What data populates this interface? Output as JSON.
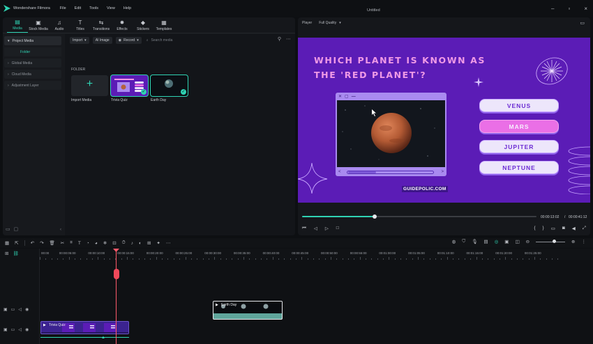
{
  "app": {
    "name": "Wondershare Filmora",
    "menus": [
      "File",
      "Edit",
      "Tools",
      "View",
      "Help"
    ],
    "document_title": "Untitled"
  },
  "toolbar_tabs": [
    {
      "label": "Media",
      "icon": "media-icon",
      "glyph": "▤"
    },
    {
      "label": "Stock Media",
      "icon": "stock-media-icon",
      "glyph": "▣"
    },
    {
      "label": "Audio",
      "icon": "music-note-icon",
      "glyph": "♫"
    },
    {
      "label": "Titles",
      "icon": "titles-icon",
      "glyph": "T"
    },
    {
      "label": "Transitions",
      "icon": "transitions-icon",
      "glyph": "⇆"
    },
    {
      "label": "Effects",
      "icon": "effects-icon",
      "glyph": "✸"
    },
    {
      "label": "Stickers",
      "icon": "stickers-icon",
      "glyph": "◆"
    },
    {
      "label": "Templates",
      "icon": "templates-icon",
      "glyph": "▦"
    }
  ],
  "sidebar": {
    "items": [
      {
        "label": "Project Media"
      },
      {
        "label": "Global Media"
      },
      {
        "label": "Cloud Media"
      },
      {
        "label": "Adjustment Layer"
      }
    ],
    "sub_item": "Folder"
  },
  "media": {
    "import_label": "Import",
    "ai_image_label": "AI Image",
    "record_label": "Record",
    "search_placeholder": "Search media",
    "folder_label": "FOLDER",
    "items": [
      {
        "label": "Import Media"
      },
      {
        "label": "Trivia Quiz"
      },
      {
        "label": "Earth Day"
      }
    ]
  },
  "player": {
    "label": "Player",
    "quality": "Full Quality",
    "current_time": "00:00:13:02",
    "separator": "/",
    "total_time": "00:00:41:12",
    "progress": 0.31
  },
  "slide": {
    "question_line1": "WHICH PLANET IS KNOWN AS",
    "question_line2": "THE 'RED PLANET'?",
    "answers": [
      "VENUS",
      "MARS",
      "JUPITER",
      "NEPTUNE"
    ],
    "highlighted_answer": "MARS",
    "brand": "GUIDEPOLIC.COM",
    "colors": {
      "background": "#5b1cb6",
      "title": "#f09ae6",
      "answer_highlight": "#ea6fe6"
    }
  },
  "timeline": {
    "ruler_labels": [
      "00:00",
      "00:00:05:00",
      "00:00:10:00",
      "00:00:15:00",
      "00:00:20:00",
      "00:00:25:00",
      "00:00:30:00",
      "00:00:35:00",
      "00:00:40:00",
      "00:00:45:00",
      "00:00:50:00",
      "00:00:55:00",
      "00:01:00:00",
      "00:01:05:00",
      "00:01:10:00",
      "00:01:15:00",
      "00:01:20:00",
      "00:01:25:00"
    ],
    "clip_earth_day": "Earth Day",
    "clip_trivia_quiz": "Trivia Quiz"
  }
}
